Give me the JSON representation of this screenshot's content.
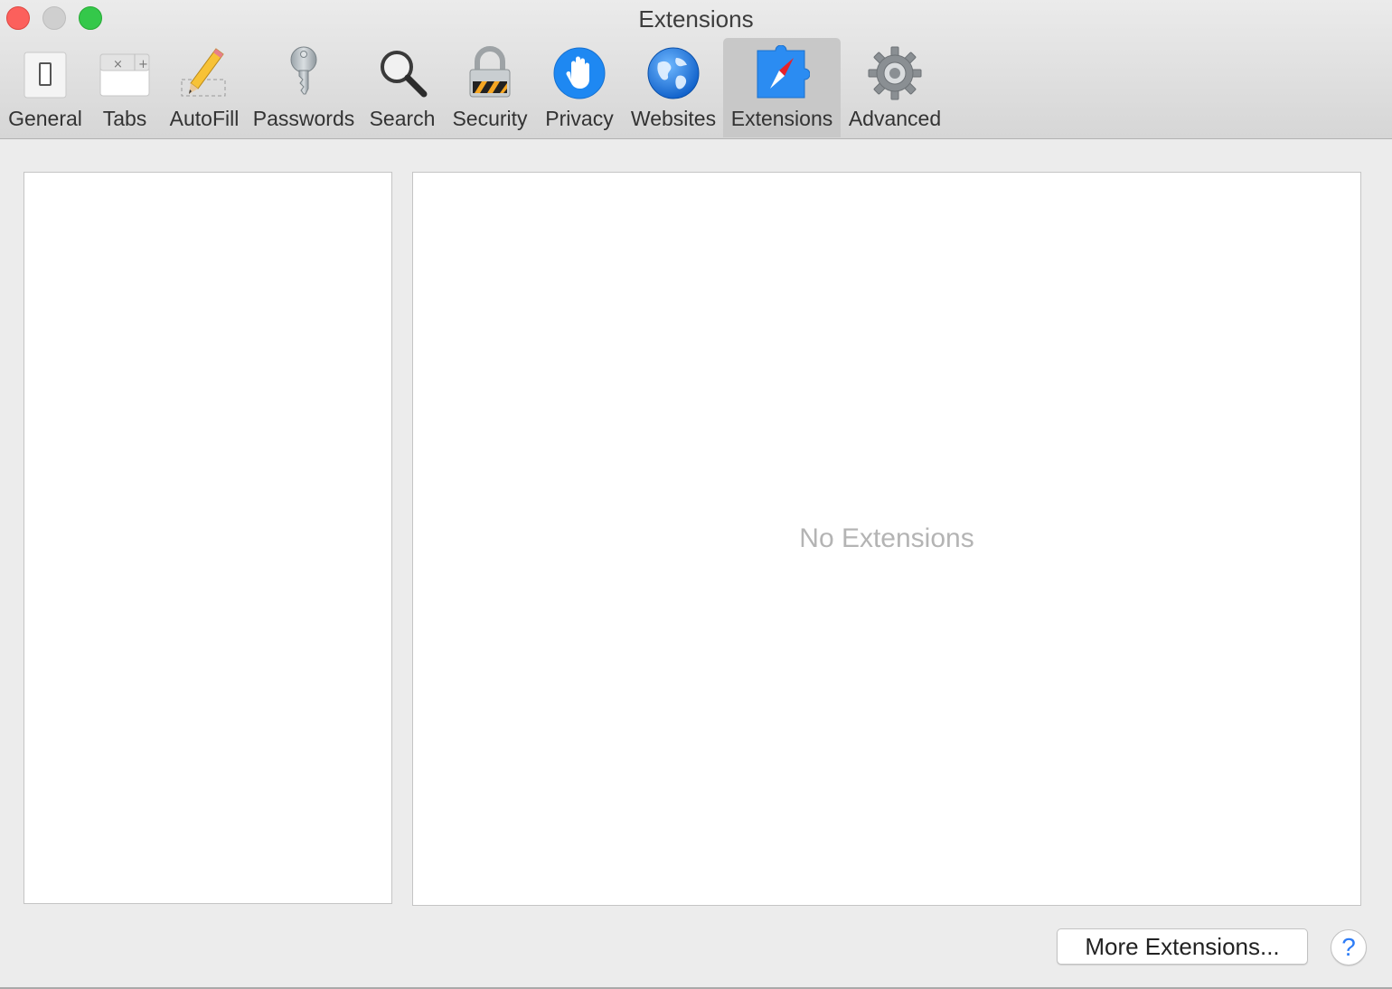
{
  "window": {
    "title": "Extensions"
  },
  "toolbar": {
    "tabs": [
      {
        "label": "General",
        "icon": "general-switch-icon"
      },
      {
        "label": "Tabs",
        "icon": "tabs-icon"
      },
      {
        "label": "AutoFill",
        "icon": "pencil-icon"
      },
      {
        "label": "Passwords",
        "icon": "key-icon"
      },
      {
        "label": "Search",
        "icon": "magnifier-icon"
      },
      {
        "label": "Security",
        "icon": "padlock-icon"
      },
      {
        "label": "Privacy",
        "icon": "hand-icon"
      },
      {
        "label": "Websites",
        "icon": "globe-icon"
      },
      {
        "label": "Extensions",
        "icon": "compass-puzzle-icon",
        "selected": true
      },
      {
        "label": "Advanced",
        "icon": "gear-icon"
      }
    ]
  },
  "main": {
    "empty_message": "No Extensions",
    "more_button": "More Extensions...",
    "help_button": "?"
  },
  "colors": {
    "accent": "#2d7cf6",
    "close": "#fc605c",
    "minimize": "#cfcfcf",
    "zoom": "#34c84a"
  }
}
